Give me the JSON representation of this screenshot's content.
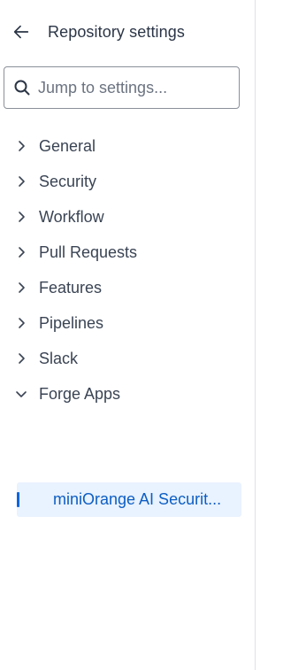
{
  "header": {
    "title": "Repository settings",
    "back_icon": "arrow-left-icon"
  },
  "search": {
    "placeholder": "Jump to settings...",
    "value": "",
    "icon": "search-icon"
  },
  "nav": {
    "items": [
      {
        "label": "General",
        "expanded": false
      },
      {
        "label": "Security",
        "expanded": false
      },
      {
        "label": "Workflow",
        "expanded": false
      },
      {
        "label": "Pull Requests",
        "expanded": false
      },
      {
        "label": "Features",
        "expanded": false
      },
      {
        "label": "Pipelines",
        "expanded": false
      },
      {
        "label": "Slack",
        "expanded": false
      },
      {
        "label": "Forge Apps",
        "expanded": true
      }
    ],
    "forge_apps_children": [
      {
        "label": "miniOrange AI Securit...",
        "selected": true
      }
    ]
  },
  "colors": {
    "selected_bg": "#e9f2ff",
    "selected_text": "#0c5ec4",
    "selected_bar": "#0c66e4",
    "text": "#3a4454",
    "border": "#8a8f99"
  }
}
